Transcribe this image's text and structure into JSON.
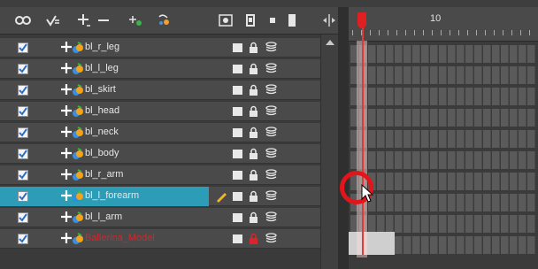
{
  "toolbar": {
    "icons": [
      "onion-skin-icon",
      "light-table-icon",
      "add-layer-icon",
      "remove-layer-icon",
      "add-peg-icon",
      "add-drawing-icon",
      "view-toggle-icon",
      "show-layer-icon",
      "lock-all-icon",
      "stack-icon",
      "split-icon"
    ]
  },
  "layers": [
    {
      "name": "bl_r_leg",
      "checked": true,
      "selected": false,
      "red": false
    },
    {
      "name": "bl_l_leg",
      "checked": true,
      "selected": false,
      "red": false
    },
    {
      "name": "bl_skirt",
      "checked": true,
      "selected": false,
      "red": false
    },
    {
      "name": "bl_head",
      "checked": true,
      "selected": false,
      "red": false
    },
    {
      "name": "bl_neck",
      "checked": true,
      "selected": false,
      "red": false
    },
    {
      "name": "bl_body",
      "checked": true,
      "selected": false,
      "red": false
    },
    {
      "name": "bl_r_arm",
      "checked": true,
      "selected": false,
      "red": false
    },
    {
      "name": "bl_l_forearm",
      "checked": true,
      "selected": true,
      "red": false
    },
    {
      "name": "bl_l_arm",
      "checked": true,
      "selected": false,
      "red": false
    },
    {
      "name": "Ballerina_Model",
      "checked": true,
      "selected": false,
      "red": true
    }
  ],
  "timeline": {
    "frame_label": "10",
    "current_frame": 1,
    "accent": "#e4141b",
    "selection_color": "#2d9cb6"
  }
}
